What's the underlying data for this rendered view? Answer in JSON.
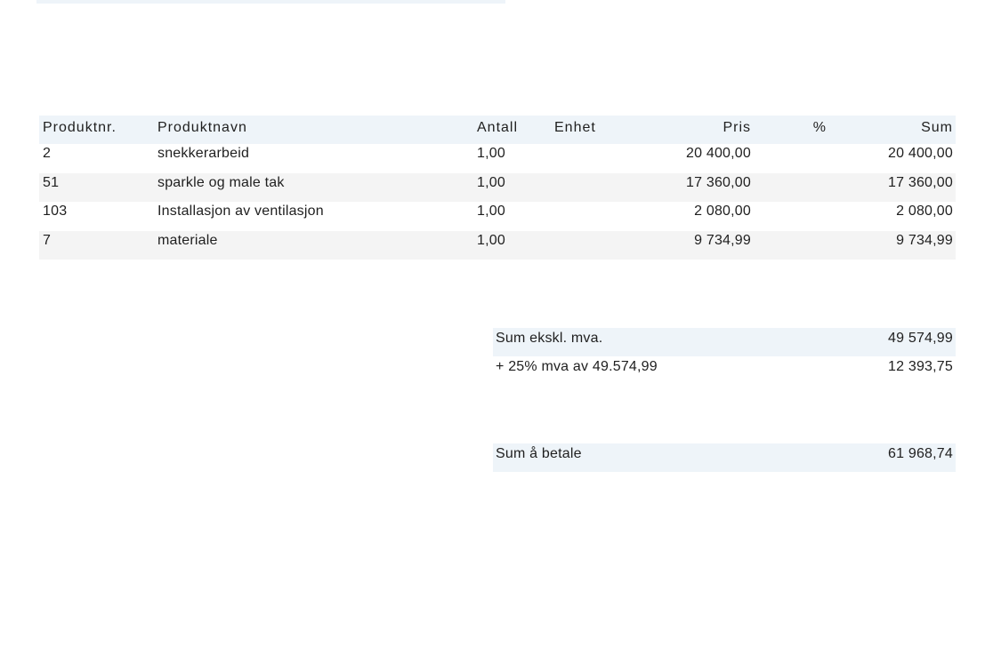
{
  "items": {
    "headers": {
      "nr": "Produktnr.",
      "name": "Produktnavn",
      "qty": "Antall",
      "unit": "Enhet",
      "price": "Pris",
      "pct": "%",
      "sum": "Sum"
    },
    "rows": [
      {
        "nr": "2",
        "name": "snekkerarbeid",
        "qty": "1,00",
        "unit": "",
        "price": "20 400,00",
        "pct": "",
        "sum": "20 400,00"
      },
      {
        "nr": "51",
        "name": "sparkle og male tak",
        "qty": "1,00",
        "unit": "",
        "price": "17 360,00",
        "pct": "",
        "sum": "17 360,00"
      },
      {
        "nr": "103",
        "name": "Installasjon av ventilasjon",
        "qty": "1,00",
        "unit": "",
        "price": "2 080,00",
        "pct": "",
        "sum": "2 080,00"
      },
      {
        "nr": "7",
        "name": "materiale",
        "qty": "1,00",
        "unit": "",
        "price": "9 734,99",
        "pct": "",
        "sum": "9 734,99"
      }
    ]
  },
  "totals": {
    "subtotal_label": "Sum ekskl. mva.",
    "subtotal_value": "49 574,99",
    "vat_label": "+ 25% mva av 49.574,99",
    "vat_value": "12 393,75",
    "total_label": "Sum å betale",
    "total_value": "61 968,74"
  },
  "colors": {
    "header_bg": "#eef4f9",
    "alt_row_bg": "#f4f4f4"
  }
}
